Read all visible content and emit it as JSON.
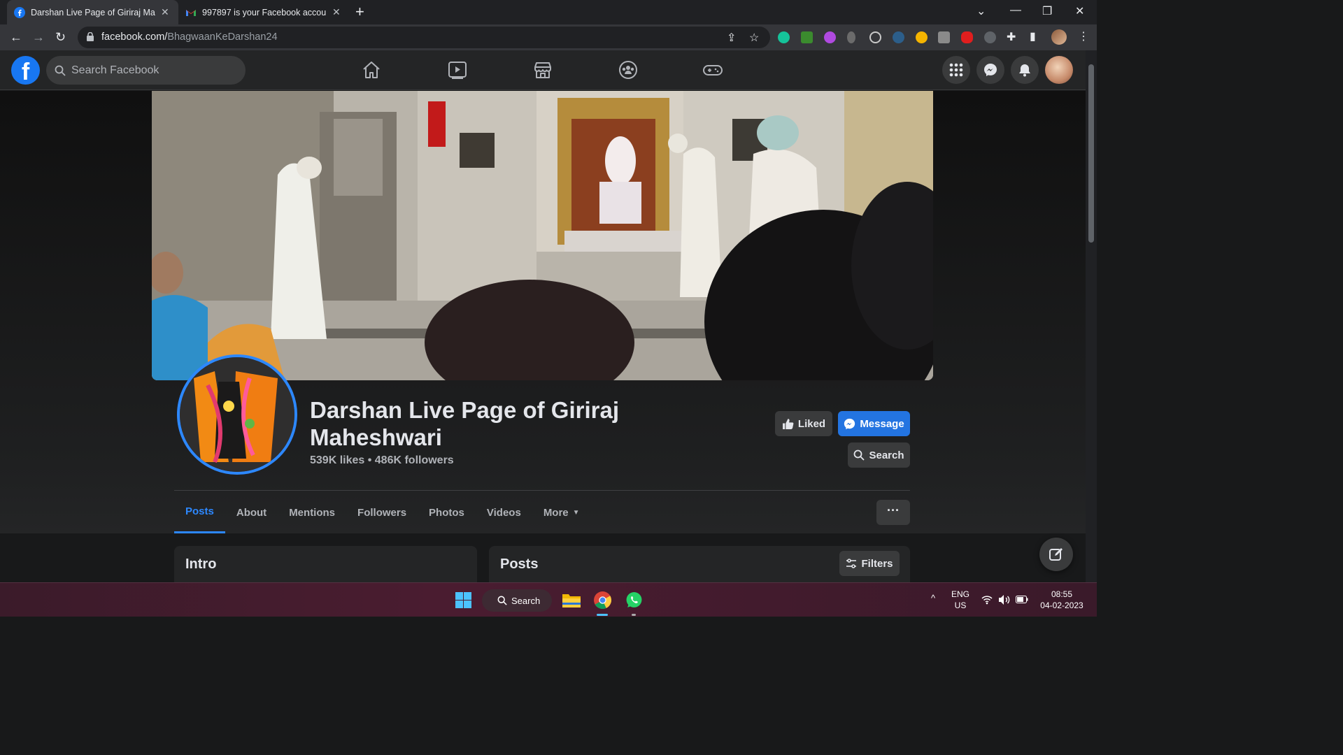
{
  "browser": {
    "tabs": [
      {
        "title": "Darshan Live Page of Giriraj Maheshwari",
        "active": true
      },
      {
        "title": "997897 is your Facebook account",
        "active": false
      }
    ],
    "url_domain": "facebook.com/",
    "url_path": "BhagwaanKeDarshan24"
  },
  "fb": {
    "search_placeholder": "Search Facebook",
    "page_name": "Darshan Live Page of Giriraj Maheshwari",
    "stats": "539K likes • 486K followers",
    "liked_label": "Liked",
    "message_label": "Message",
    "search_label": "Search",
    "tabs": [
      "Posts",
      "About",
      "Mentions",
      "Followers",
      "Photos",
      "Videos",
      "More"
    ],
    "dots_label": "···",
    "intro_title": "Intro",
    "posts_title": "Posts",
    "filters_label": "Filters",
    "accent": "#2d88ff"
  },
  "taskbar": {
    "search_label": "Search",
    "lang_1": "ENG",
    "lang_2": "US",
    "time": "08:55",
    "date": "04-02-2023"
  }
}
